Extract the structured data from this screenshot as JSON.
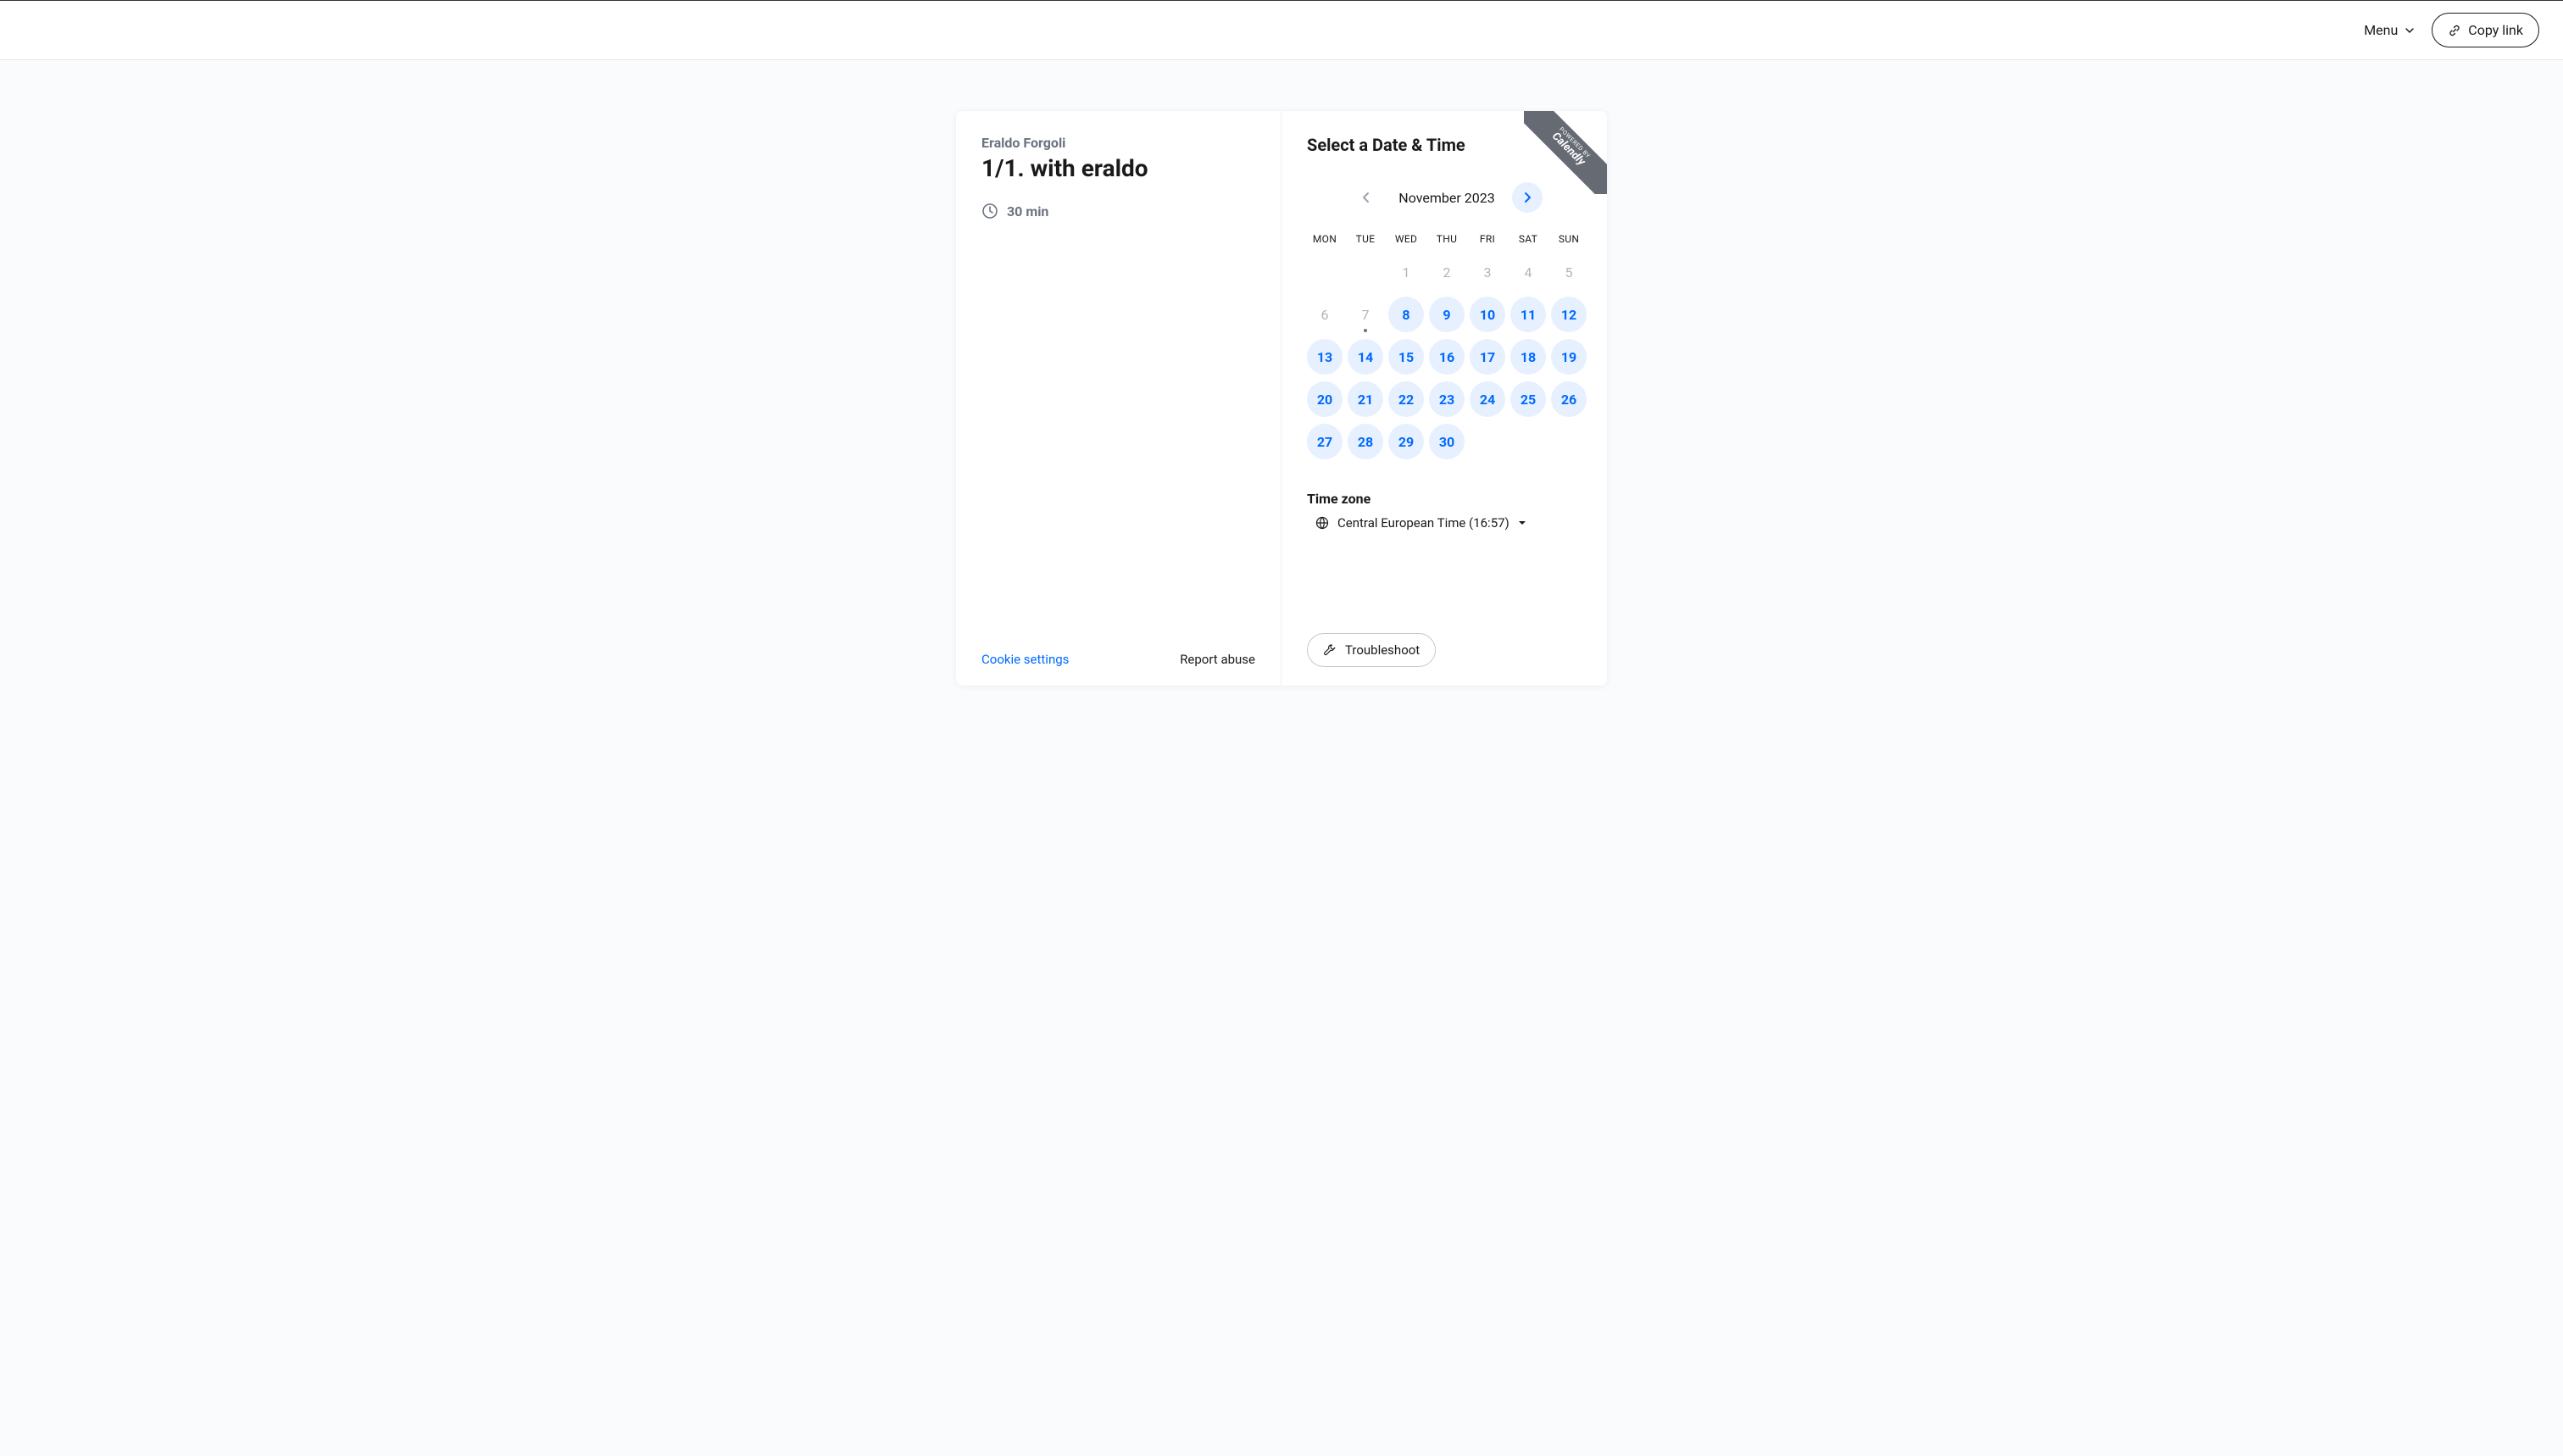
{
  "header": {
    "menu_label": "Menu",
    "copy_link_label": "Copy link"
  },
  "event": {
    "organizer": "Eraldo Forgoli",
    "title": "1/1. with eraldo",
    "duration": "30 min"
  },
  "footer": {
    "cookie_settings": "Cookie settings",
    "report_abuse": "Report abuse",
    "troubleshoot": "Troubleshoot"
  },
  "calendar": {
    "heading": "Select a Date & Time",
    "month_label": "November 2023",
    "weekdays": [
      "MON",
      "TUE",
      "WED",
      "THU",
      "FRI",
      "SAT",
      "SUN"
    ],
    "weeks": [
      [
        {
          "n": "",
          "available": false,
          "today": false
        },
        {
          "n": "",
          "available": false,
          "today": false
        },
        {
          "n": "1",
          "available": false,
          "today": false
        },
        {
          "n": "2",
          "available": false,
          "today": false
        },
        {
          "n": "3",
          "available": false,
          "today": false
        },
        {
          "n": "4",
          "available": false,
          "today": false
        },
        {
          "n": "5",
          "available": false,
          "today": false
        }
      ],
      [
        {
          "n": "6",
          "available": false,
          "today": false
        },
        {
          "n": "7",
          "available": false,
          "today": true
        },
        {
          "n": "8",
          "available": true,
          "today": false
        },
        {
          "n": "9",
          "available": true,
          "today": false
        },
        {
          "n": "10",
          "available": true,
          "today": false
        },
        {
          "n": "11",
          "available": true,
          "today": false
        },
        {
          "n": "12",
          "available": true,
          "today": false
        }
      ],
      [
        {
          "n": "13",
          "available": true,
          "today": false
        },
        {
          "n": "14",
          "available": true,
          "today": false
        },
        {
          "n": "15",
          "available": true,
          "today": false
        },
        {
          "n": "16",
          "available": true,
          "today": false
        },
        {
          "n": "17",
          "available": true,
          "today": false
        },
        {
          "n": "18",
          "available": true,
          "today": false
        },
        {
          "n": "19",
          "available": true,
          "today": false
        }
      ],
      [
        {
          "n": "20",
          "available": true,
          "today": false
        },
        {
          "n": "21",
          "available": true,
          "today": false
        },
        {
          "n": "22",
          "available": true,
          "today": false
        },
        {
          "n": "23",
          "available": true,
          "today": false
        },
        {
          "n": "24",
          "available": true,
          "today": false
        },
        {
          "n": "25",
          "available": true,
          "today": false
        },
        {
          "n": "26",
          "available": true,
          "today": false
        }
      ],
      [
        {
          "n": "27",
          "available": true,
          "today": false
        },
        {
          "n": "28",
          "available": true,
          "today": false
        },
        {
          "n": "29",
          "available": true,
          "today": false
        },
        {
          "n": "30",
          "available": true,
          "today": false
        },
        {
          "n": "",
          "available": false,
          "today": false
        },
        {
          "n": "",
          "available": false,
          "today": false
        },
        {
          "n": "",
          "available": false,
          "today": false
        }
      ]
    ]
  },
  "timezone": {
    "heading": "Time zone",
    "selected": "Central European Time (16:57)"
  },
  "ribbon": {
    "small": "POWERED BY",
    "large": "Calendly"
  }
}
